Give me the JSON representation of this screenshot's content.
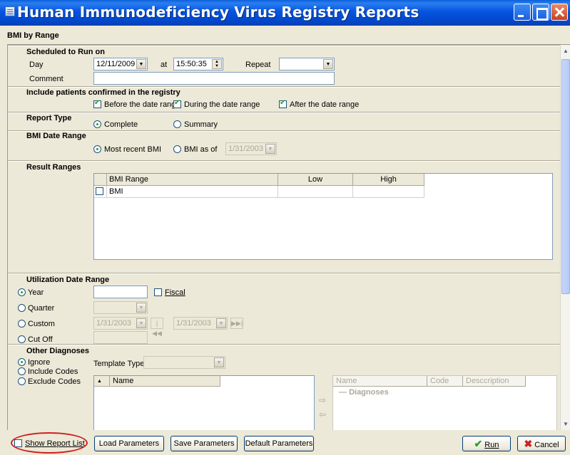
{
  "window": {
    "title": "Human Immunodeficiency Virus Registry Reports"
  },
  "report": {
    "title": "BMI by Range"
  },
  "schedule": {
    "section": "Scheduled to Run on",
    "day_label": "Day",
    "day_value": "12/11/2009",
    "at_label": "at",
    "time_value": "15:50:35",
    "repeat_label": "Repeat",
    "repeat_value": "",
    "comment_label": "Comment",
    "comment_value": ""
  },
  "include": {
    "section": "Include patients confirmed in the registry",
    "before": {
      "label": "Before the date range",
      "checked": true
    },
    "during": {
      "label": "During the date range",
      "checked": true
    },
    "after": {
      "label": "After the date range",
      "checked": true
    }
  },
  "report_type": {
    "section": "Report Type",
    "complete": "Complete",
    "summary": "Summary",
    "selected": "Complete"
  },
  "bmi_date_range": {
    "section": "BMI Date Range",
    "most_recent": "Most recent BMI",
    "as_of": "BMI as of",
    "as_of_date": "1/31/2003",
    "selected": "Most recent BMI"
  },
  "result_ranges": {
    "section": "Result Ranges",
    "columns": [
      "BMI Range",
      "Low",
      "High"
    ],
    "rows": [
      {
        "name": "BMI",
        "low": "",
        "high": ""
      }
    ]
  },
  "utilization": {
    "section": "Utilization Date Range",
    "year": "Year",
    "year_value": "",
    "fiscal": "Fiscal",
    "quarter": "Quarter",
    "custom": "Custom",
    "custom_from": "1/31/2003",
    "custom_to": "1/31/2003",
    "cut_off": "Cut Off",
    "selected": "Year"
  },
  "other_diagnoses": {
    "section": "Other Diagnoses",
    "ignore": "Ignore",
    "include_codes": "Include Codes",
    "exclude_codes": "Exclude Codes",
    "selected": "Ignore",
    "template_type_label": "Template Type",
    "template_type_value": "",
    "left_list": {
      "sort_glyph": "▲",
      "columns": [
        "Name"
      ]
    },
    "right_list": {
      "columns": [
        "Name",
        "Code",
        "Desccription"
      ],
      "group": "Diagnoses"
    }
  },
  "bottom": {
    "show_report_list": "Show Report List",
    "load": "Load Parameters",
    "save": "Save Parameters",
    "default": "Default Parameters",
    "run": "Run",
    "cancel": "Cancel"
  },
  "icons": {
    "run": "green-check-icon",
    "cancel": "red-x-icon",
    "add": "arrow-right-icon",
    "remove": "arrow-left-icon"
  },
  "colors": {
    "titlebar": "#0554e0",
    "face": "#ece9d8",
    "check": "#21a121",
    "highlight": "#d02020"
  }
}
